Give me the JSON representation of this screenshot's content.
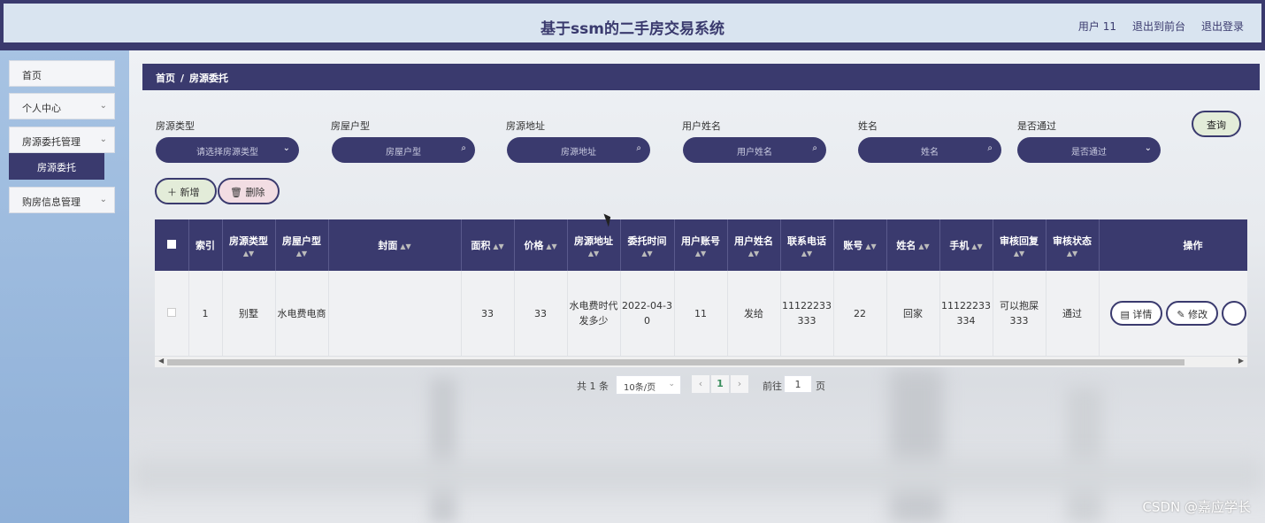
{
  "header": {
    "title": "基于ssm的二手房交易系统",
    "user": "用户 11",
    "back_front": "退出到前台",
    "logout": "退出登录"
  },
  "sidebar": {
    "items": [
      {
        "label": "首页"
      },
      {
        "label": "个人中心"
      },
      {
        "label": "房源委托管理"
      },
      {
        "label": "房源委托"
      },
      {
        "label": "购房信息管理"
      }
    ]
  },
  "breadcrumb": {
    "home": "首页",
    "sep": "/",
    "current": "房源委托"
  },
  "filters": [
    {
      "label": "房源类型",
      "placeholder": "请选择房源类型",
      "icon": "chevron-down-icon"
    },
    {
      "label": "房屋户型",
      "placeholder": "房屋户型",
      "icon": "search-icon"
    },
    {
      "label": "房源地址",
      "placeholder": "房源地址",
      "icon": "search-icon"
    },
    {
      "label": "用户姓名",
      "placeholder": "用户姓名",
      "icon": "search-icon"
    },
    {
      "label": "姓名",
      "placeholder": "姓名",
      "icon": "search-icon"
    },
    {
      "label": "是否通过",
      "placeholder": "是否通过",
      "icon": "chevron-down-icon"
    }
  ],
  "query_label": "查询",
  "add_label": "＋ 新增",
  "delete_label": "🗑 删除",
  "table": {
    "columns": [
      "索引",
      "房源类型",
      "房屋户型",
      "封面",
      "面积",
      "价格",
      "房源地址",
      "委托时间",
      "用户账号",
      "用户姓名",
      "联系电话",
      "账号",
      "姓名",
      "手机",
      "审核回复",
      "审核状态",
      "操作"
    ],
    "rows": [
      {
        "index": "1",
        "type": "别墅",
        "layout": "水电费电商",
        "cover": "",
        "area": "33",
        "price": "33",
        "address": "水电费时代发多少",
        "time": "2022-04-30",
        "account": "11",
        "username": "发给",
        "phone": "11122233333",
        "acct": "22",
        "name": "回家",
        "mobile": "11122233334",
        "reply": "可以抱屎333",
        "status": "通过"
      }
    ],
    "detail_label": "详情",
    "edit_label": "修改"
  },
  "pagination": {
    "total": "共 1 条",
    "page_size": "10条/页",
    "current": "1",
    "goto_label": "前往",
    "goto_value": "1",
    "page_label": "页"
  },
  "watermark": "CSDN @嘉应学长",
  "colors": {
    "primary": "#3a3a6e",
    "sidebar": "#9ab8dd",
    "header_bg": "#d9e4f0"
  }
}
